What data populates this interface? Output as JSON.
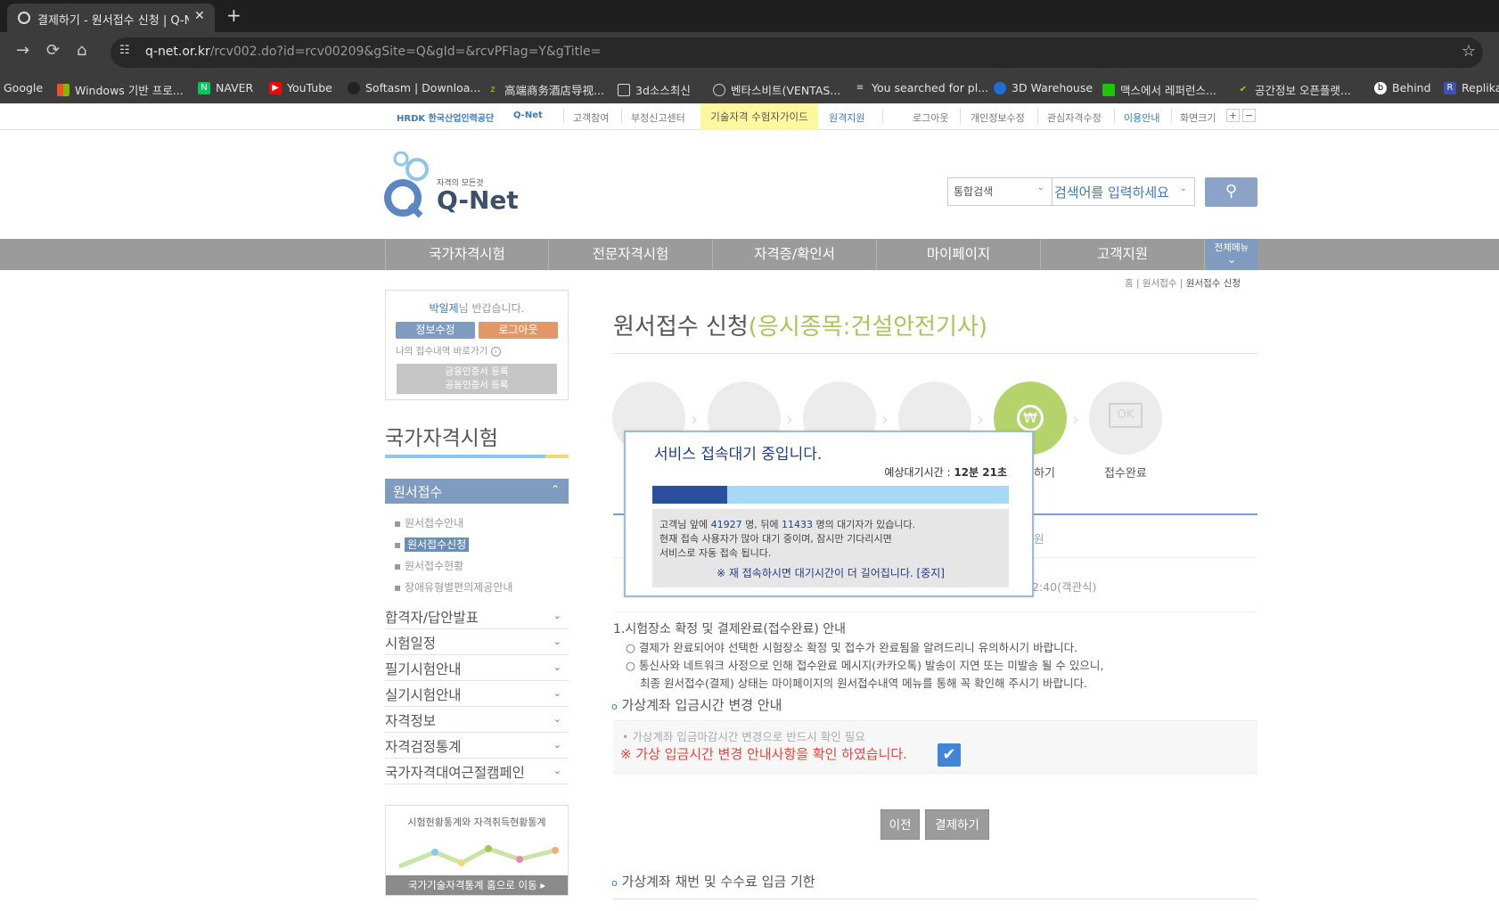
{
  "browser": {
    "tab_title": "결제하기 - 원서접수 신청 | Q-N",
    "url_host": "q-net.or.kr",
    "url_path": "/rcv002.do?id=rcv00209&gSite=Q&gId=&rcvPFlag=Y&gTitle=",
    "bookmarks": [
      "Google",
      "Windows 기반 프로...",
      "NAVER",
      "YouTube",
      "Softasm | Downloa...",
      "高端商务酒店导视...",
      "3d소스최신",
      "벤타스비트(VENTAS...",
      "You searched for pl...",
      "3D Warehouse",
      "맥스에서 레퍼런스...",
      "공간정보 오픈플랫...",
      "Behind",
      "Replika"
    ]
  },
  "topbar": {
    "brand1": "HRDK 한국산업인력공단",
    "brand2": "Q-Net",
    "links_left": [
      "고객참여",
      "부정신고센터"
    ],
    "guide": "기술자격 수험자가이드",
    "remote": "원격지원",
    "links_right": [
      "로그아웃",
      "개인정보수정",
      "관심자격수정",
      "이용안내",
      "화면크기"
    ],
    "zoom_plus": "+",
    "zoom_minus": "−"
  },
  "header": {
    "logo_sub": "자격의 모든것",
    "logo_main": "Q-Net",
    "search_type": "통합검색",
    "search_placeholder": "검색어를 입력하세요"
  },
  "gnb": [
    "국가자격시험",
    "전문자격시험",
    "자격증/확인서",
    "마이페이지",
    "고객지원"
  ],
  "allmenu": "전체메뉴",
  "welcome": {
    "name": "박일제",
    "greet": "님 반갑습니다.",
    "edit": "정보수정",
    "logout": "로그아웃",
    "shortcut": "나의 접수내역 바로가기",
    "cert1": "금융인증서 등록",
    "cert2": "공동인증서 등록"
  },
  "sidebar": {
    "title": "국가자격시험",
    "active": "원서접수",
    "subs": [
      "원서접수안내",
      "원서접수신청",
      "원서접수현황",
      "장애유형별편의제공안내"
    ],
    "items": [
      "합격자/답안발표",
      "시험일정",
      "필기시험안내",
      "실기시험안내",
      "자격정보",
      "자격검정통계",
      "국가자격대여근절캠페인"
    ],
    "stat_title": "시험현황통계와 자격취득현황통계",
    "stat_btn": "국가기술자격통계 홈으로 이동"
  },
  "main": {
    "breadcrumb": [
      "홈",
      "원서접수",
      "원서접수 신청"
    ],
    "title": "원서접수 신청",
    "title_sub": "(응시종목:건설안전기사)",
    "step5_label": "하기",
    "step6_label": "접수완료",
    "step6_icon": "OK",
    "hidden_time": "2:40(객관식)",
    "hidden_link": "원",
    "notice_title": "1.시험장소 확정 및 결제완료(접수완료) 안내",
    "notice1": "결제가 완료되어야 선택한 시험장소 확정 및 접수가 완료됨을 알려드리니 유의하시기 바랍니다.",
    "notice2": "통신사와 네트워크 사정으로 인해 접수완료 메시지(카카오톡) 발송이 지연 또는 미발송 될 수 있으니,",
    "notice3": "최종 원서접수(결제) 상태는 마이페이지의 원서접수내역 메뉴를 통해 꼭 확인해 주시기 바랍니다.",
    "vacct_title": "가상계좌 입금시간 변경 안내",
    "vacct_note": "• 가상계좌 입금마감시간 변경으로 반드시 확인 필요",
    "vacct_confirm": "※ 가상 입금시간 변경 안내사항을 확인 하였습니다.",
    "btn_prev": "이전",
    "btn_pay": "결제하기",
    "vacct2_title": "가상계좌 채번 및 수수료 입금 기한"
  },
  "modal": {
    "title": "서비스 접속대기 중입니다.",
    "wait_label": "예상대기시간 : ",
    "wait_value": "12분 21초",
    "progress": 0.21,
    "line1_a": "고객님 앞에 ",
    "ahead": "41927",
    "line1_b": " 명, 뒤에 ",
    "behind": "11433",
    "line1_c": " 명의 대기자가 있습니다.",
    "line2": "현재 접속 사용자가 많아 대기 중이며, 잠시만 기다리시면",
    "line3": "서비스로 자동 접속 됩니다.",
    "stop": "※ 재 접속하시면 대기시간이 더 길어집니다. [중지]"
  },
  "colors": {
    "accent": "#7f9bbf",
    "green": "#a8c55a",
    "modal_blue": "#1e3c8a",
    "warn": "#e8463a"
  }
}
